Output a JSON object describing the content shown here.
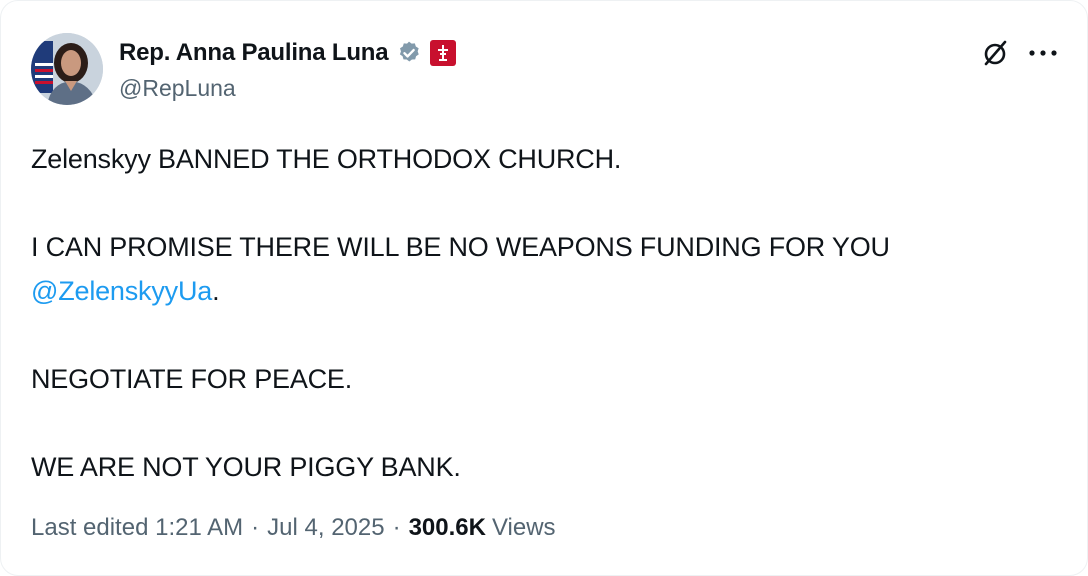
{
  "author": {
    "display_name": "Rep. Anna Paulina Luna",
    "handle": "@RepLuna",
    "verified_icon": "verified-badge-gray",
    "affiliation_icon": "us-house-seal",
    "affiliation_color": "#c8102e"
  },
  "actions": {
    "grok_icon": "grok-slash-circle-icon",
    "more_icon": "more-horizontal-icon"
  },
  "tweet": {
    "line1": "Zelenskyy BANNED THE ORTHODOX CHURCH.",
    "line2_text": "I CAN PROMISE THERE WILL BE NO WEAPONS FUNDING FOR YOU",
    "line2_mention": "@ZelenskyyUa",
    "line2_end": ".",
    "line3": "NEGOTIATE FOR PEACE.",
    "line4": "WE ARE NOT YOUR PIGGY BANK."
  },
  "meta": {
    "edited_label": "Last edited",
    "time": "1:21 AM",
    "separator": "·",
    "date": "Jul 4, 2025",
    "views_count": "300.6K",
    "views_label": "Views"
  },
  "colors": {
    "text_primary": "#0f1419",
    "text_secondary": "#536471",
    "link": "#1d9bf0",
    "verified_gray": "#829aab"
  }
}
